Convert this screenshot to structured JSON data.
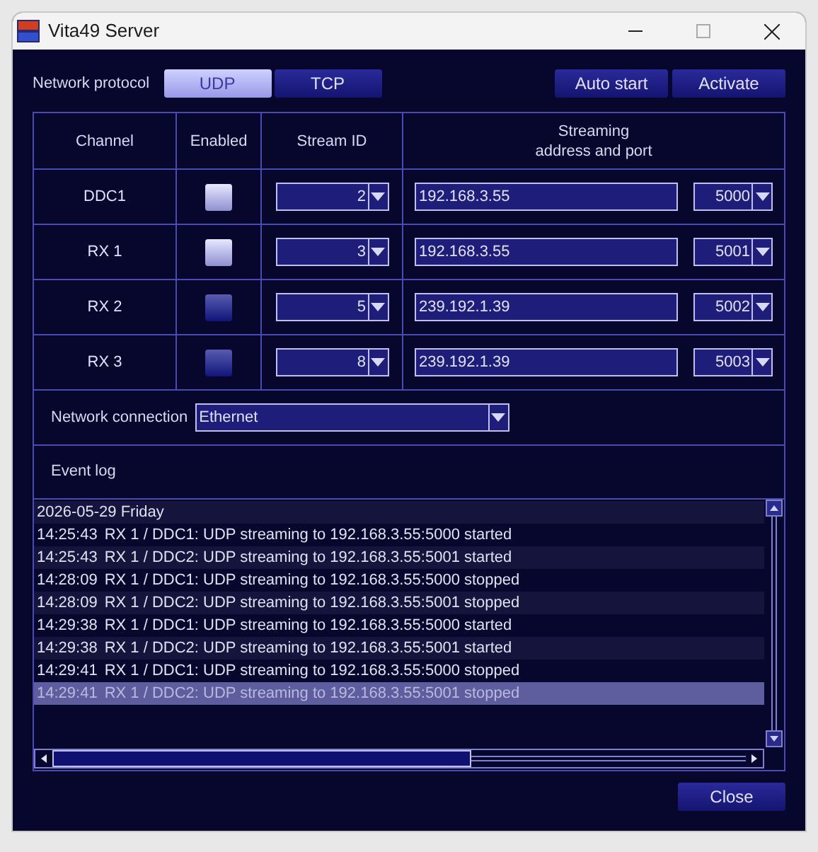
{
  "window": {
    "title": "Vita49 Server"
  },
  "protocol": {
    "label": "Network protocol",
    "options": [
      {
        "label": "UDP",
        "selected": true
      },
      {
        "label": "TCP",
        "selected": false
      }
    ]
  },
  "actions": [
    "Auto start",
    "Activate"
  ],
  "table": {
    "columns": [
      "Channel",
      "Enabled",
      "Stream ID",
      "Streaming\naddress and port"
    ],
    "rows": [
      {
        "channel": "DDC1",
        "enabled": true,
        "stream_id": "2",
        "address": "192.168.3.55",
        "port": "5000"
      },
      {
        "channel": "RX 1",
        "enabled": true,
        "stream_id": "3",
        "address": "192.168.3.55",
        "port": "5001"
      },
      {
        "channel": "RX 2",
        "enabled": false,
        "stream_id": "5",
        "address": "239.192.1.39",
        "port": "5002"
      },
      {
        "channel": "RX 3",
        "enabled": false,
        "stream_id": "8",
        "address": "239.192.1.39",
        "port": "5003"
      }
    ]
  },
  "network_connection": {
    "label": "Network connection",
    "value": "Ethernet"
  },
  "event_log": {
    "label": "Event log",
    "entries": [
      {
        "kind": "date",
        "text": "2026-05-29 Friday",
        "selected": false
      },
      {
        "kind": "event",
        "time": "14:25:43",
        "text": "RX 1 / DDC1: UDP streaming to 192.168.3.55:5000 started",
        "selected": false
      },
      {
        "kind": "event",
        "time": "14:25:43",
        "text": "RX 1 / DDC2: UDP streaming to 192.168.3.55:5001 started",
        "selected": false
      },
      {
        "kind": "event",
        "time": "14:28:09",
        "text": "RX 1 / DDC1: UDP streaming to 192.168.3.55:5000 stopped",
        "selected": false
      },
      {
        "kind": "event",
        "time": "14:28:09",
        "text": "RX 1 / DDC2: UDP streaming to 192.168.3.55:5001 stopped",
        "selected": false
      },
      {
        "kind": "event",
        "time": "14:29:38",
        "text": "RX 1 / DDC1: UDP streaming to 192.168.3.55:5000 started",
        "selected": false
      },
      {
        "kind": "event",
        "time": "14:29:38",
        "text": "RX 1 / DDC2: UDP streaming to 192.168.3.55:5001 started",
        "selected": false
      },
      {
        "kind": "event",
        "time": "14:29:41",
        "text": "RX 1 / DDC1: UDP streaming to 192.168.3.55:5000 stopped",
        "selected": false
      },
      {
        "kind": "event",
        "time": "14:29:41",
        "text": "RX 1 / DDC2: UDP streaming to 192.168.3.55:5001 stopped",
        "selected": true
      }
    ]
  },
  "close_button": "Close"
}
